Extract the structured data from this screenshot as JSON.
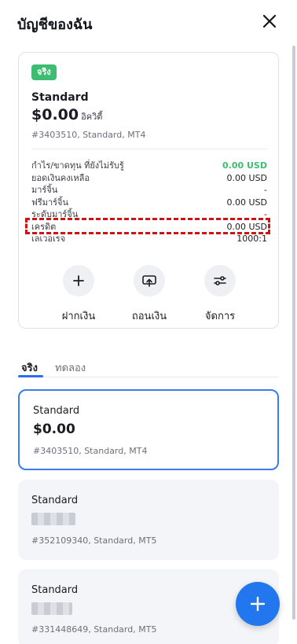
{
  "header": {
    "title": "บัญชีของฉัน",
    "close_icon": "close-icon"
  },
  "account_card": {
    "badge": "จริง",
    "name": "Standard",
    "balance": "$0.00",
    "balance_suffix": "อิควิตี้",
    "subtitle": "#3403510, Standard, MT4",
    "stats": [
      {
        "label": "กำไร/ขาดทุน ที่ยังไม่รับรู้",
        "value": "0.00 USD",
        "color": "#3dbd72"
      },
      {
        "label": "ยอดเงินคงเหลือ",
        "value": "0.00 USD"
      },
      {
        "label": "มาร์จิ้น",
        "value": "-"
      },
      {
        "label": "ฟรีมาร์จิ้น",
        "value": "0.00 USD"
      },
      {
        "label": "ระดับมาร์จิ้น",
        "value": "-"
      },
      {
        "label": "เครดิต",
        "value": "0.00 USD"
      },
      {
        "label": "เลเวอเรจ",
        "value": "1000:1"
      }
    ],
    "actions": [
      {
        "label": "ฝากเงิน",
        "icon": "plus-icon"
      },
      {
        "label": "ถอนเงิน",
        "icon": "withdraw-icon"
      },
      {
        "label": "จัดการ",
        "icon": "manage-icon"
      }
    ]
  },
  "tabs": {
    "real": "จริง",
    "demo": "ทดลอง"
  },
  "accounts": [
    {
      "name": "Standard",
      "balance": "$0.00",
      "subtitle": "#3403510, Standard, MT4",
      "selected": true
    },
    {
      "name": "Standard",
      "subtitle": "#352109340, Standard, MT5"
    },
    {
      "name": "Standard",
      "subtitle": "#331448649, Standard, MT5"
    }
  ],
  "colors": {
    "accent": "#2c6df0",
    "green": "#3dbd72",
    "highlight": "#cc1616",
    "fab": "#2277ee"
  }
}
